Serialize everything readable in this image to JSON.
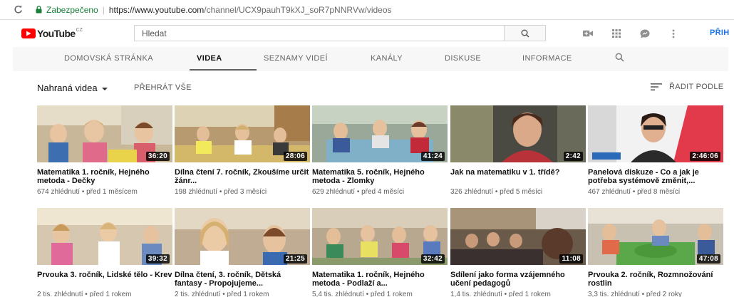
{
  "browser": {
    "secure_label": "Zabezpečeno",
    "url_host": "https://www.youtube.com",
    "url_path": "/channel/UCX9pauhT9kXJ_soR7pNNRVw/videos"
  },
  "masthead": {
    "logo_text": "YouTube",
    "logo_region": "CZ",
    "search_placeholder": "Hledat",
    "signin_label": "PŘIH"
  },
  "tabs": [
    {
      "label": "DOMOVSKÁ STRÁNKA",
      "active": false
    },
    {
      "label": "VIDEA",
      "active": true
    },
    {
      "label": "SEZNAMY VIDEÍ",
      "active": false
    },
    {
      "label": "KANÁLY",
      "active": false
    },
    {
      "label": "DISKUSE",
      "active": false
    },
    {
      "label": "INFORMACE",
      "active": false
    }
  ],
  "toolbar": {
    "section_title": "Nahraná videa",
    "play_all": "PŘEHRÁT VŠE",
    "sort_label": "ŘADIT PODLE"
  },
  "videos": [
    {
      "title": "Matematika 1. ročník, Hejného metoda - Dečky",
      "meta": "674 zhlédnutí • před 1 měsícem",
      "duration": "36:20"
    },
    {
      "title": "Dílna čtení 7. ročník, Zkoušíme určit žánr...",
      "meta": "198 zhlédnutí • před 3 měsíci",
      "duration": "28:06"
    },
    {
      "title": "Matematika 5. ročník, Hejného metoda - Zlomky",
      "meta": "629 zhlédnutí • před 4 měsíci",
      "duration": "41:24"
    },
    {
      "title": "Jak na matematiku v 1. třídě?",
      "meta": "326 zhlédnutí • před 5 měsíci",
      "duration": "2:42"
    },
    {
      "title": "Panelová diskuze - Co a jak je potřeba systémově změnit,...",
      "meta": "467 zhlédnutí • před 8 měsíci",
      "duration": "2:46:06"
    },
    {
      "title": "Prvouka 3. ročník, Lidské tělo - Krev",
      "meta": "2 tis. zhlédnutí • před 1 rokem",
      "duration": "39:32"
    },
    {
      "title": "Dílna čtení, 3. ročník, Dětská fantasy - Propojujeme...",
      "meta": "2 tis. zhlédnutí • před 1 rokem",
      "duration": "21:25"
    },
    {
      "title": "Matematika 1. ročník, Hejného metoda - Podlaží a...",
      "meta": "5,4 tis. zhlédnutí • před 1 rokem",
      "duration": "32:42"
    },
    {
      "title": "Sdílení jako forma vzájemného učení pedagogů",
      "meta": "1,4 tis. zhlédnutí • před 1 rokem",
      "duration": "11:08"
    },
    {
      "title": "Prvouka 2. ročník, Rozmnožování rostlin",
      "meta": "3,3 tis. zhlédnutí • před 2 roky",
      "duration": "47:08"
    }
  ],
  "colors": {
    "brand_red": "#ff0000",
    "link_blue": "#1a73e8",
    "secure_green": "#188038"
  }
}
